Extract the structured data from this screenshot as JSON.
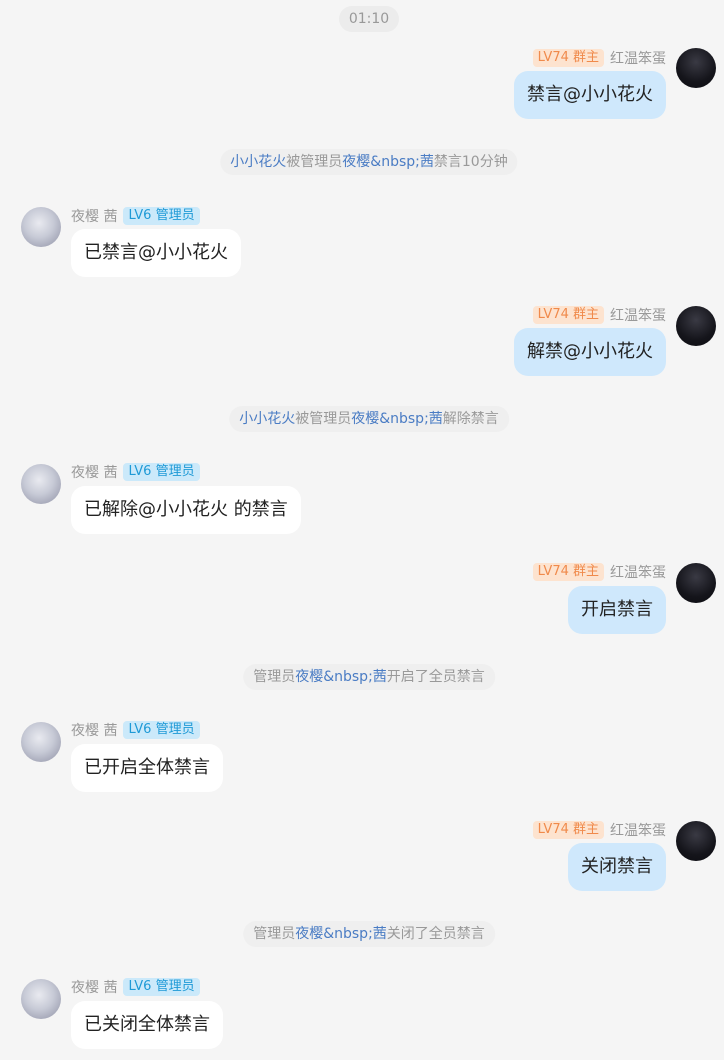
{
  "chat": {
    "timestamp": "01:10",
    "me": {
      "name": "红温笨蛋",
      "badge": "LV74 群主"
    },
    "admin": {
      "name": "夜樱 茜",
      "badge": "LV6 管理员"
    },
    "messages": [
      {
        "text": "禁言@小小花火"
      },
      {
        "sys_target": "小小花火",
        "sys_mid": "被管理员",
        "sys_actor": "夜樱&nbsp;茜",
        "sys_tail": "禁言10分钟"
      },
      {
        "text": "已禁言@小小花火"
      },
      {
        "text": "解禁@小小花火"
      },
      {
        "sys_target": "小小花火",
        "sys_mid": "被管理员",
        "sys_actor": "夜樱&nbsp;茜",
        "sys_tail": "解除禁言"
      },
      {
        "text": "已解除@小小花火 的禁言"
      },
      {
        "text": "开启禁言"
      },
      {
        "sys_head": "管理员",
        "sys_actor": "夜樱&nbsp;茜",
        "sys_tail": "开启了全员禁言"
      },
      {
        "text": "已开启全体禁言"
      },
      {
        "text": "关闭禁言"
      },
      {
        "sys_head": "管理员",
        "sys_actor": "夜樱&nbsp;茜",
        "sys_tail": "关闭了全员禁言"
      },
      {
        "text": "已关闭全体禁言"
      }
    ]
  },
  "colors": {
    "background": "#f5f5f5",
    "my_bubble": "#cfe8fc",
    "other_bubble": "#ffffff",
    "link": "#4a7cc4",
    "owner_badge_text": "#f08a4b",
    "admin_badge_text": "#1f9ad6"
  },
  "icons": {
    "my_avatar": "avatar-dark-hair",
    "admin_avatar": "avatar-white-hair"
  }
}
